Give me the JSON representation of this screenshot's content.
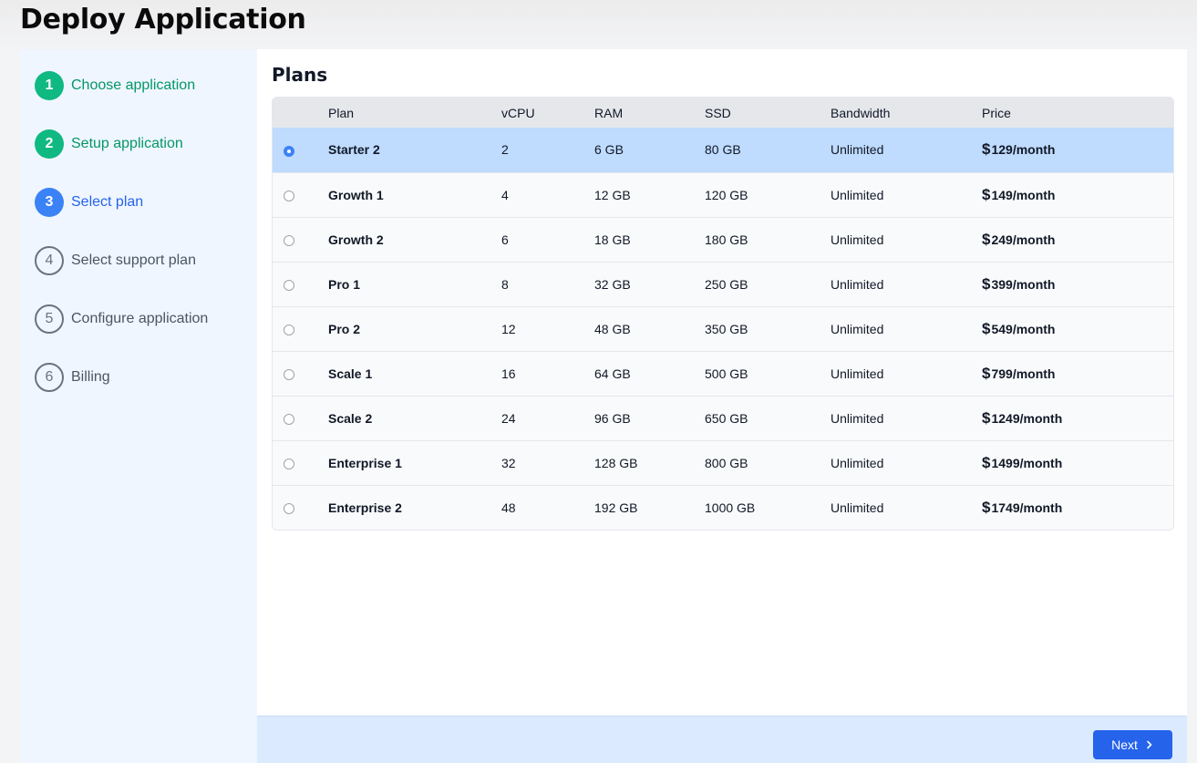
{
  "page": {
    "title": "Deploy Application"
  },
  "steps": [
    {
      "number": "1",
      "label": "Choose application",
      "status": "done"
    },
    {
      "number": "2",
      "label": "Setup application",
      "status": "done"
    },
    {
      "number": "3",
      "label": "Select plan",
      "status": "current"
    },
    {
      "number": "4",
      "label": "Select support plan",
      "status": "todo"
    },
    {
      "number": "5",
      "label": "Configure application",
      "status": "todo"
    },
    {
      "number": "6",
      "label": "Billing",
      "status": "todo"
    }
  ],
  "plans": {
    "title": "Plans",
    "columns": [
      "Plan",
      "vCPU",
      "RAM",
      "SSD",
      "Bandwidth",
      "Price"
    ],
    "currency_symbol": "$",
    "rows": [
      {
        "name": "Starter 2",
        "vcpu": "2",
        "ram": "6 GB",
        "ssd": "80 GB",
        "bandwidth": "Unlimited",
        "price": "129/month",
        "selected": true
      },
      {
        "name": "Growth 1",
        "vcpu": "4",
        "ram": "12 GB",
        "ssd": "120 GB",
        "bandwidth": "Unlimited",
        "price": "149/month",
        "selected": false
      },
      {
        "name": "Growth 2",
        "vcpu": "6",
        "ram": "18 GB",
        "ssd": "180 GB",
        "bandwidth": "Unlimited",
        "price": "249/month",
        "selected": false
      },
      {
        "name": "Pro 1",
        "vcpu": "8",
        "ram": "32 GB",
        "ssd": "250 GB",
        "bandwidth": "Unlimited",
        "price": "399/month",
        "selected": false
      },
      {
        "name": "Pro 2",
        "vcpu": "12",
        "ram": "48 GB",
        "ssd": "350 GB",
        "bandwidth": "Unlimited",
        "price": "549/month",
        "selected": false
      },
      {
        "name": "Scale 1",
        "vcpu": "16",
        "ram": "64 GB",
        "ssd": "500 GB",
        "bandwidth": "Unlimited",
        "price": "799/month",
        "selected": false
      },
      {
        "name": "Scale 2",
        "vcpu": "24",
        "ram": "96 GB",
        "ssd": "650 GB",
        "bandwidth": "Unlimited",
        "price": "1249/month",
        "selected": false
      },
      {
        "name": "Enterprise 1",
        "vcpu": "32",
        "ram": "128 GB",
        "ssd": "800 GB",
        "bandwidth": "Unlimited",
        "price": "1499/month",
        "selected": false
      },
      {
        "name": "Enterprise 2",
        "vcpu": "48",
        "ram": "192 GB",
        "ssd": "1000 GB",
        "bandwidth": "Unlimited",
        "price": "1749/month",
        "selected": false
      }
    ]
  },
  "footer": {
    "next_label": "Next",
    "next_icon": "chevron-right-icon"
  },
  "colors": {
    "accent": "#2563eb",
    "success": "#10b981",
    "selected_row": "#bfdbfe",
    "sidebar_bg": "#eff6ff",
    "footer_bg": "#dbeafe"
  }
}
